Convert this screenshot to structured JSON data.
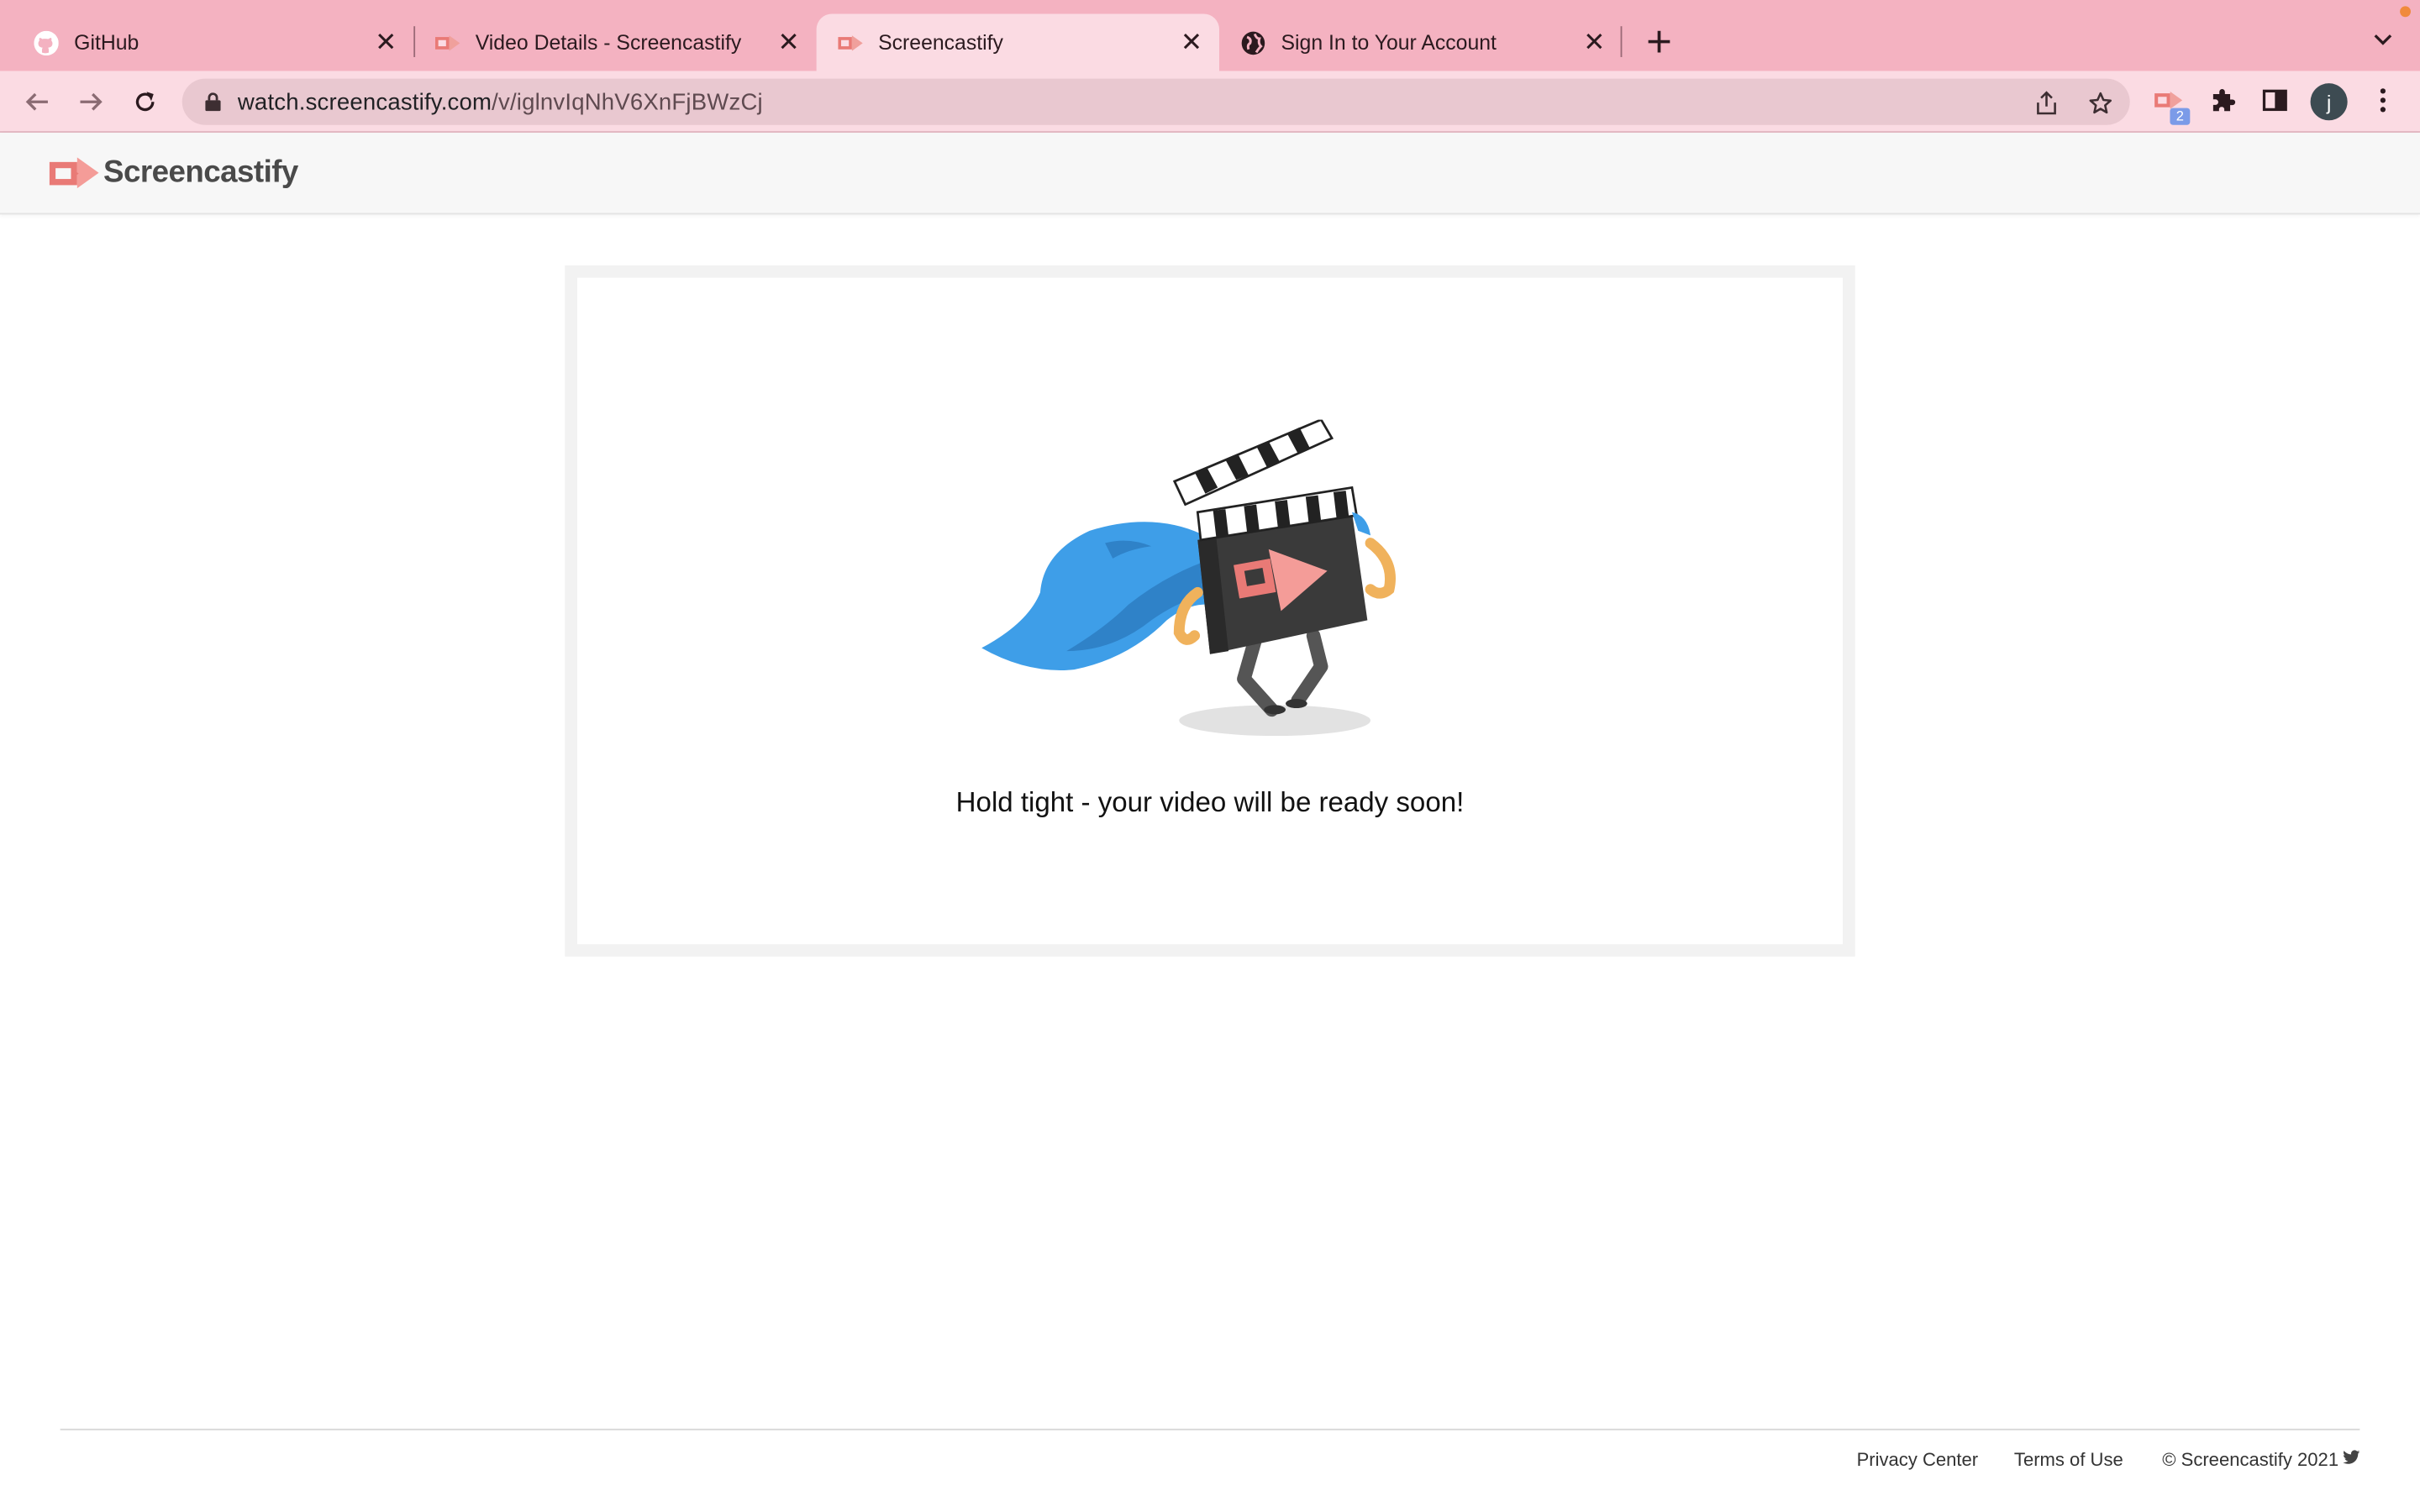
{
  "browser": {
    "tabs": [
      {
        "title": "GitHub",
        "favicon": "github-icon",
        "active": false
      },
      {
        "title": "Video Details - Screencastify",
        "favicon": "screencastify-icon",
        "active": false
      },
      {
        "title": "Screencastify",
        "favicon": "screencastify-icon",
        "active": true
      },
      {
        "title": "Sign In to Your Account",
        "favicon": "globe-icon",
        "active": false
      }
    ],
    "address_bar": {
      "domain": "watch.screencastify.com",
      "path": "/v/iglnvIqNhV6XnFjBWzCj"
    },
    "extension_badge": "2",
    "profile_initial": "j",
    "colors": {
      "tabstrip": "#f4b2c1",
      "toolbar": "#fbdbe3"
    }
  },
  "site": {
    "brand_name": "Screencastify",
    "status_message": "Hold tight - your video will be ready soon!",
    "footer": {
      "privacy": "Privacy Center",
      "terms": "Terms of Use",
      "copyright": "© Screencastify 2021"
    },
    "colors": {
      "brand_accent": "#f07f7a",
      "cape": "#3e9ee8"
    }
  }
}
